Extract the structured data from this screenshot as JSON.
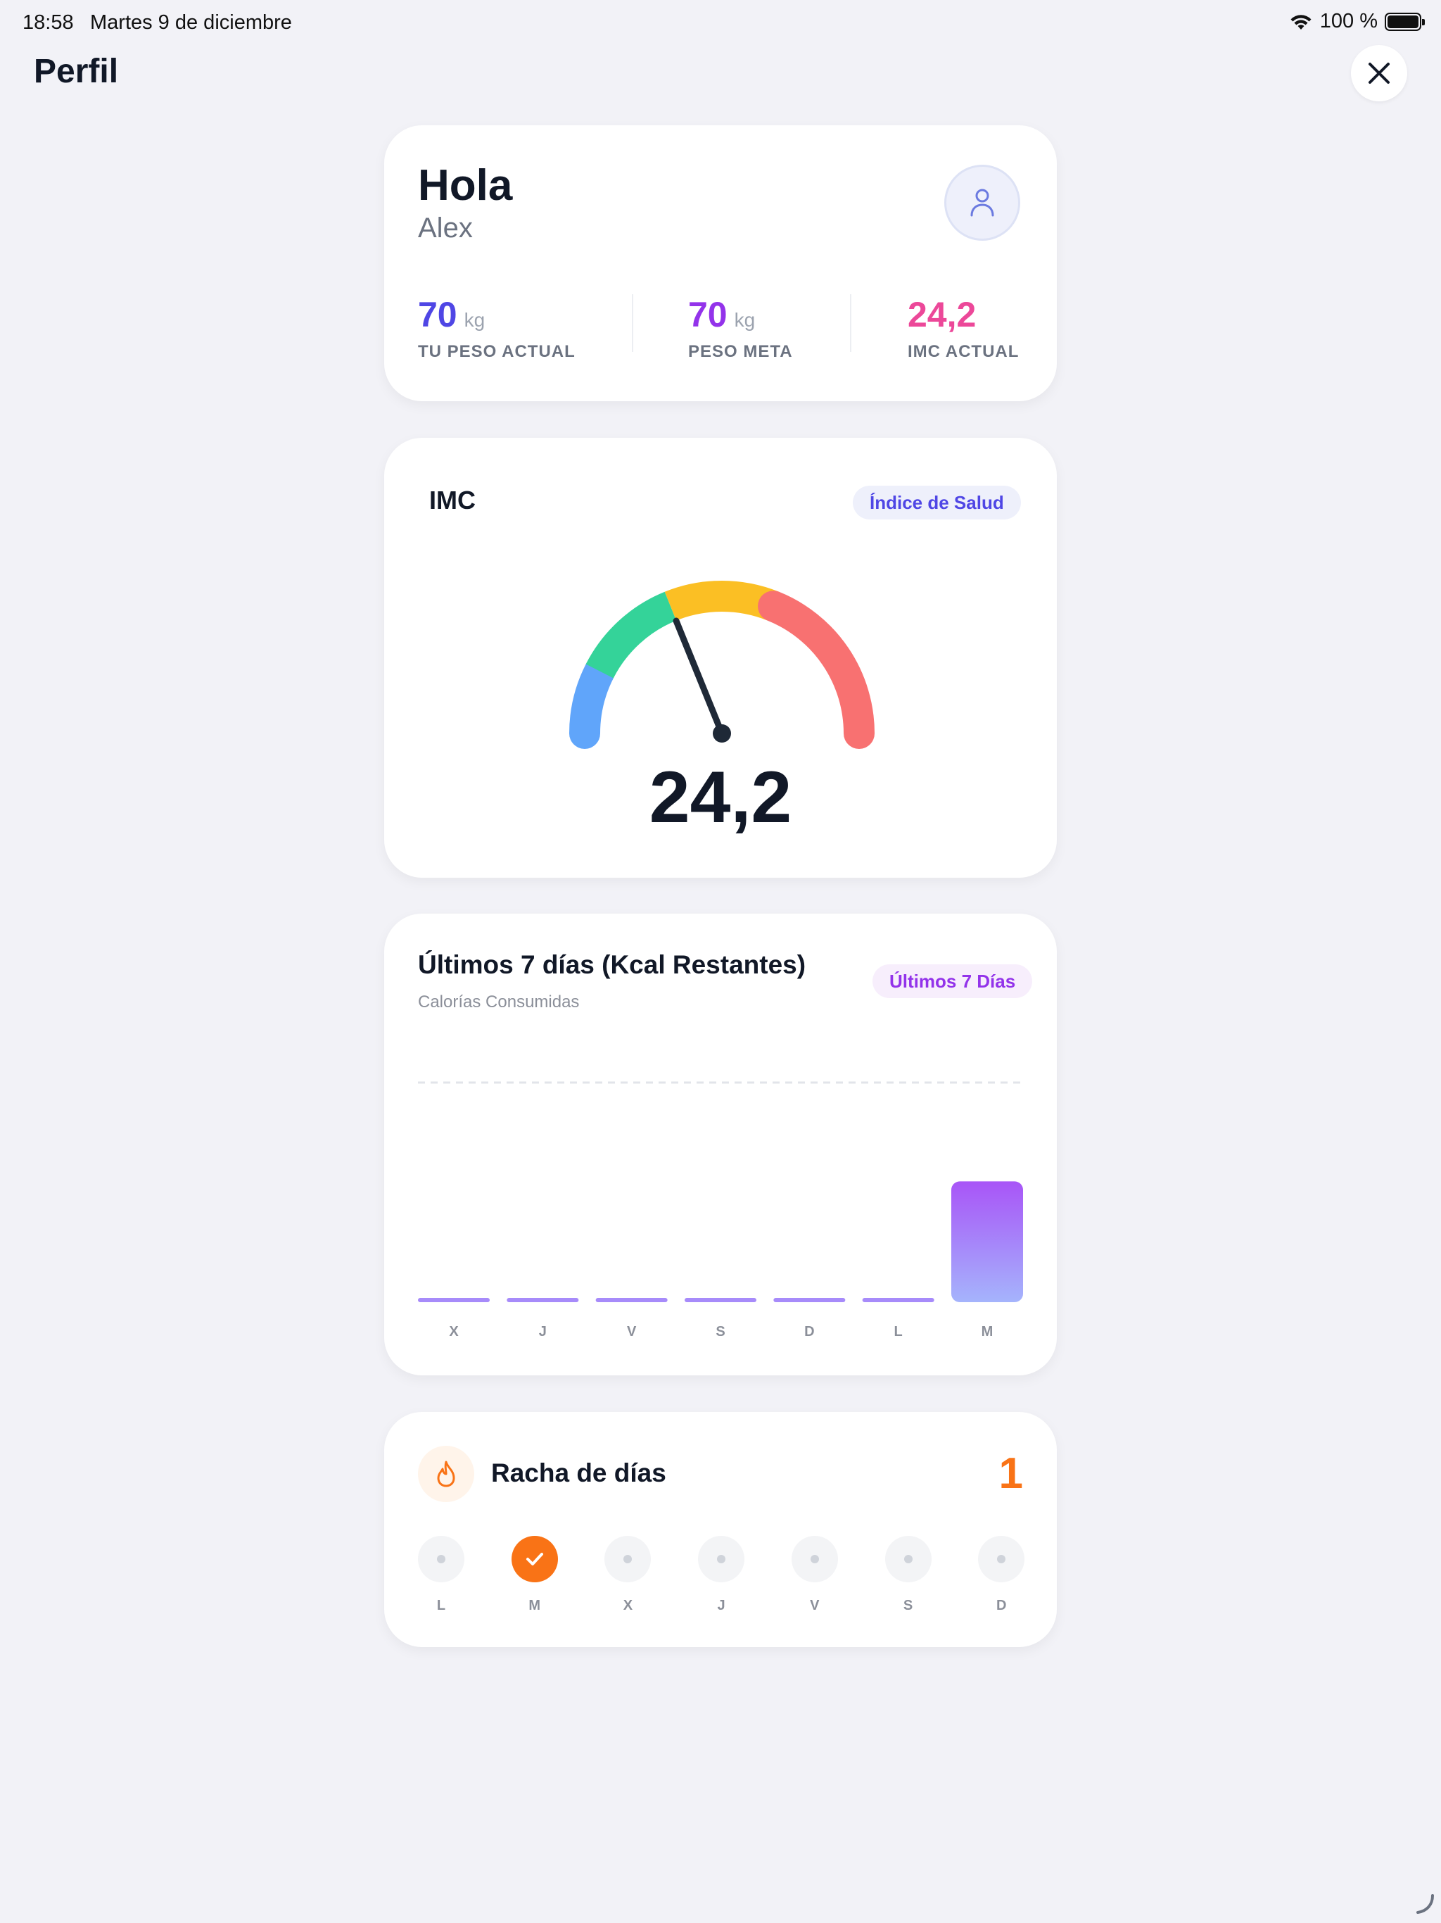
{
  "status_bar": {
    "time": "18:58",
    "date": "Martes 9 de diciembre",
    "battery": "100 %"
  },
  "header": {
    "title": "Perfil"
  },
  "profile": {
    "greeting": "Hola",
    "name": "Alex",
    "stats": [
      {
        "value": "70",
        "unit": "kg",
        "label": "TU PESO ACTUAL",
        "color": "#4f46e5"
      },
      {
        "value": "70",
        "unit": "kg",
        "label": "PESO META",
        "color": "#9333ea"
      },
      {
        "value": "24,2",
        "unit": "",
        "label": "IMC ACTUAL",
        "color": "#ec4899"
      }
    ]
  },
  "imc": {
    "title": "IMC",
    "badge": "Índice de Salud",
    "value": "24,2",
    "segment_colors": [
      "#60a5fa",
      "#34d399",
      "#fbbf24",
      "#f87171"
    ]
  },
  "chart": {
    "title": "Últimos 7 días (Kcal Restantes)",
    "subtitle": "Calorías Consumidas",
    "badge": "Últimos 7 Días"
  },
  "chart_data": {
    "type": "bar",
    "categories": [
      "X",
      "J",
      "V",
      "S",
      "D",
      "L",
      "M"
    ],
    "values": [
      0,
      0,
      0,
      0,
      0,
      0,
      0.55
    ],
    "target": 1,
    "ylim": [
      0,
      1
    ],
    "grid": false
  },
  "streak": {
    "title": "Racha de días",
    "count": "1",
    "days": [
      {
        "label": "L",
        "done": false
      },
      {
        "label": "M",
        "done": true
      },
      {
        "label": "X",
        "done": false
      },
      {
        "label": "J",
        "done": false
      },
      {
        "label": "V",
        "done": false
      },
      {
        "label": "S",
        "done": false
      },
      {
        "label": "D",
        "done": false
      }
    ]
  }
}
